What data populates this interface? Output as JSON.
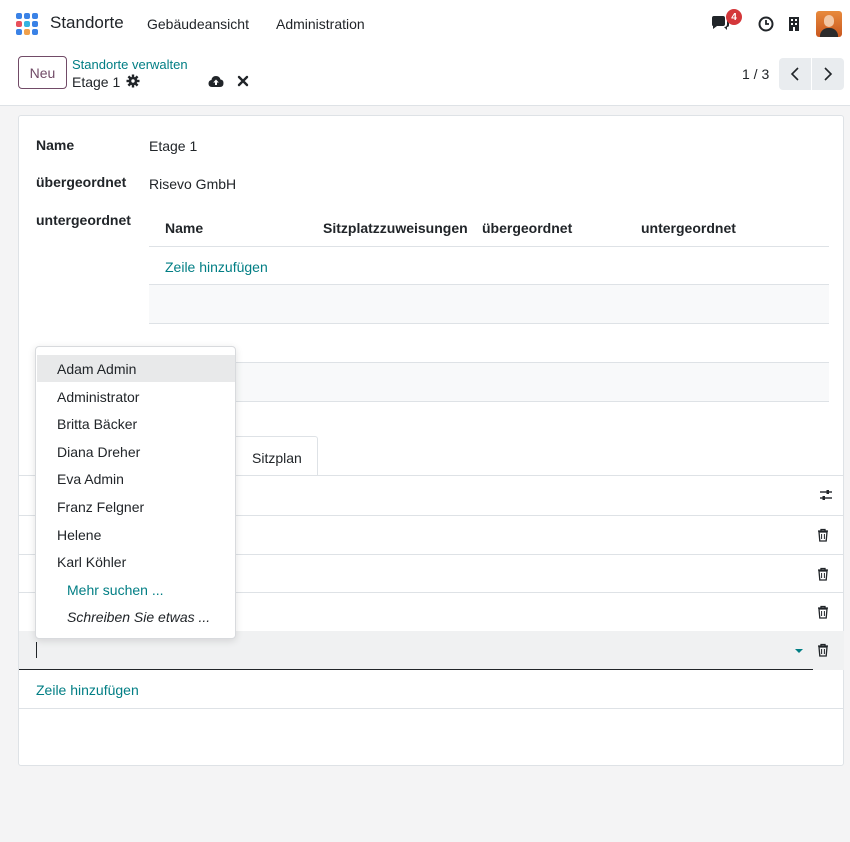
{
  "navbar": {
    "app_name": "Standorte",
    "menu": [
      "Gebäudeansicht",
      "Administration"
    ],
    "messages_badge": "4"
  },
  "control_panel": {
    "new_label": "Neu",
    "breadcrumb_parent": "Standorte verwalten",
    "breadcrumb_current": "Etage 1",
    "pager": "1 / 3"
  },
  "form": {
    "name_label": "Name",
    "name_value": "Etage 1",
    "parent_label": "übergeordnet",
    "parent_value": "Risevo GmbH",
    "children_label": "untergeordnet",
    "children_table": {
      "columns": [
        "Name",
        "Sitzplatzzuweisungen",
        "übergeordnet",
        "untergeordnet"
      ],
      "add_line": "Zeile hinzufügen"
    },
    "tab_label": "Sitzplan",
    "seat_table": {
      "add_line": "Zeile hinzufügen"
    }
  },
  "dropdown": {
    "items": [
      "Adam Admin",
      "Administrator",
      "Britta Bäcker",
      "Diana Dreher",
      "Eva Admin",
      "Franz Felgner",
      "Helene",
      "Karl Köhler"
    ],
    "search_more": "Mehr suchen ...",
    "write_something": "Schreiben Sie etwas ..."
  },
  "colors": {
    "link": "#017e84",
    "primary": "#714b67",
    "badge": "#d4373a"
  }
}
